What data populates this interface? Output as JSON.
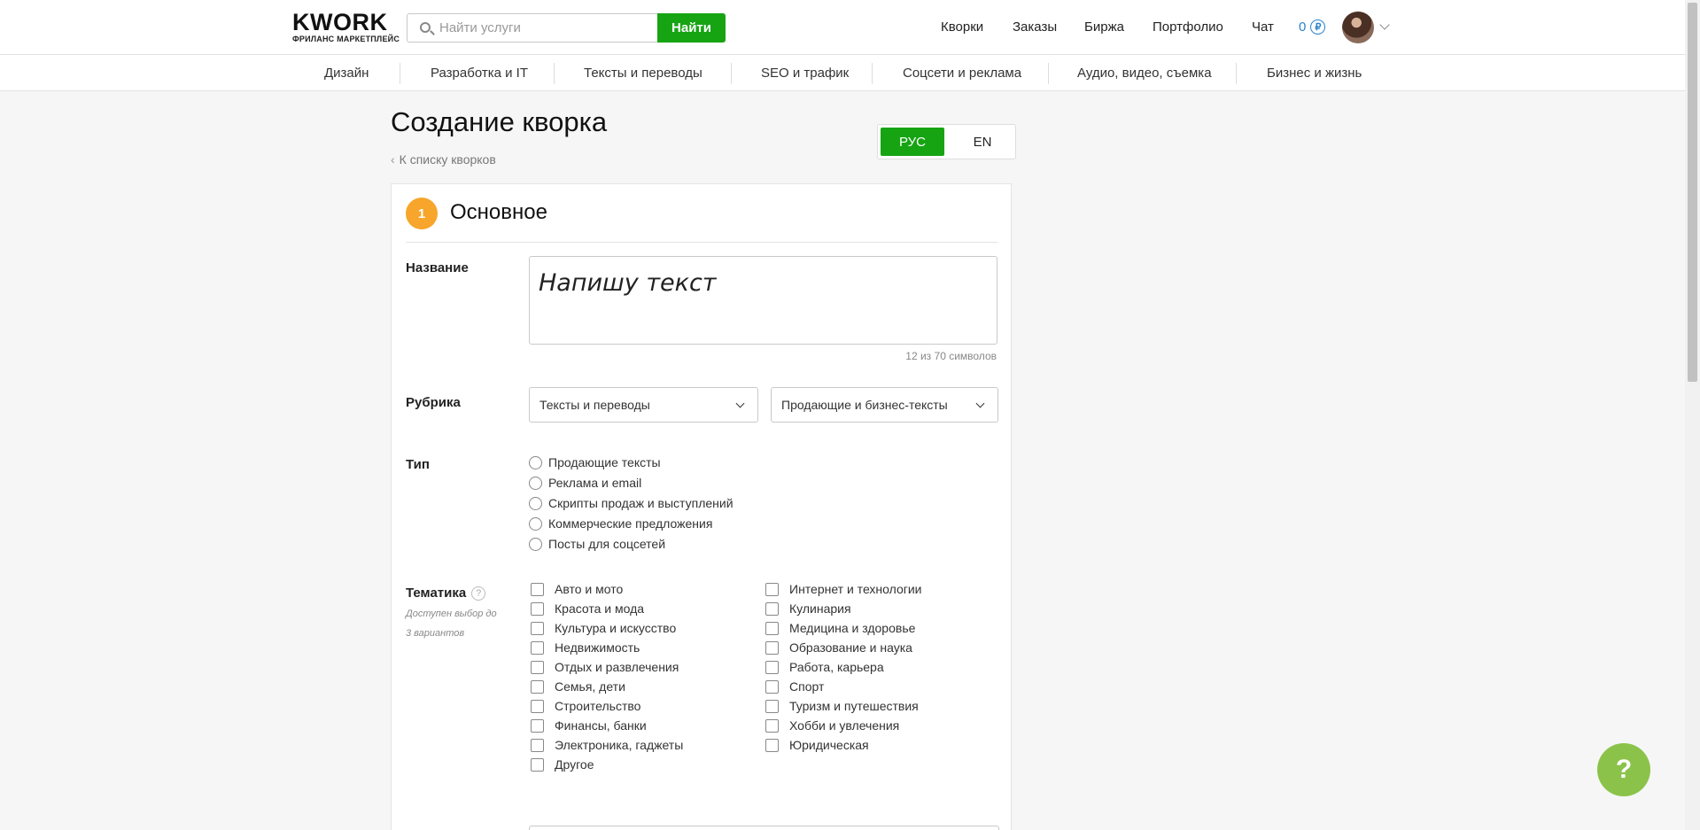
{
  "header": {
    "logo": "KWORK",
    "logo_sub": "ФРИЛАНС МАРКЕТПЛЕЙС",
    "search_placeholder": "Найти услуги",
    "search_button": "Найти",
    "nav": [
      "Кворки",
      "Заказы",
      "Биржа",
      "Портфолио",
      "Чат"
    ],
    "balance": "0",
    "currency_symbol": "₽"
  },
  "categories": [
    "Дизайн",
    "Разработка и IT",
    "Тексты и переводы",
    "SEO и трафик",
    "Соцсети и реклама",
    "Аудио, видео, съемка",
    "Бизнес и жизнь"
  ],
  "page": {
    "title": "Создание кворка",
    "back_link": "К списку кворков",
    "lang_ru": "РУС",
    "lang_en": "EN"
  },
  "section": {
    "number": "1",
    "title": "Основное"
  },
  "form": {
    "name_label": "Название",
    "name_value": "Напишу текст",
    "name_counter": "12 из 70 символов",
    "rubric_label": "Рубрика",
    "rubric_value": "Тексты и переводы",
    "subrubric_value": "Продающие и бизнес-тексты",
    "type_label": "Тип",
    "types": [
      "Продающие тексты",
      "Реклама и email",
      "Скрипты продаж и выступлений",
      "Коммерческие предложения",
      "Посты для соцсетей"
    ],
    "theme_label": "Тематика",
    "theme_help": "?",
    "theme_hint": "Доступен выбор до 3 вариантов",
    "themes_left": [
      "Авто и мото",
      "Красота и мода",
      "Культура и искусство",
      "Недвижимость",
      "Отдых и развлечения",
      "Семья, дети",
      "Строительство",
      "Финансы, банки",
      "Электроника, гаджеты",
      "Другое"
    ],
    "themes_right": [
      "Интернет и технологии",
      "Кулинария",
      "Медицина и здоровье",
      "Образование и наука",
      "Работа, карьера",
      "Спорт",
      "Туризм и путешествия",
      "Хобби и увлечения",
      "Юридическая"
    ]
  },
  "help_fab": "?",
  "colors": {
    "accent_green": "#16a413",
    "step_orange": "#f7a52b",
    "fab_green": "#8bc34a",
    "link_blue": "#2b82c9"
  }
}
